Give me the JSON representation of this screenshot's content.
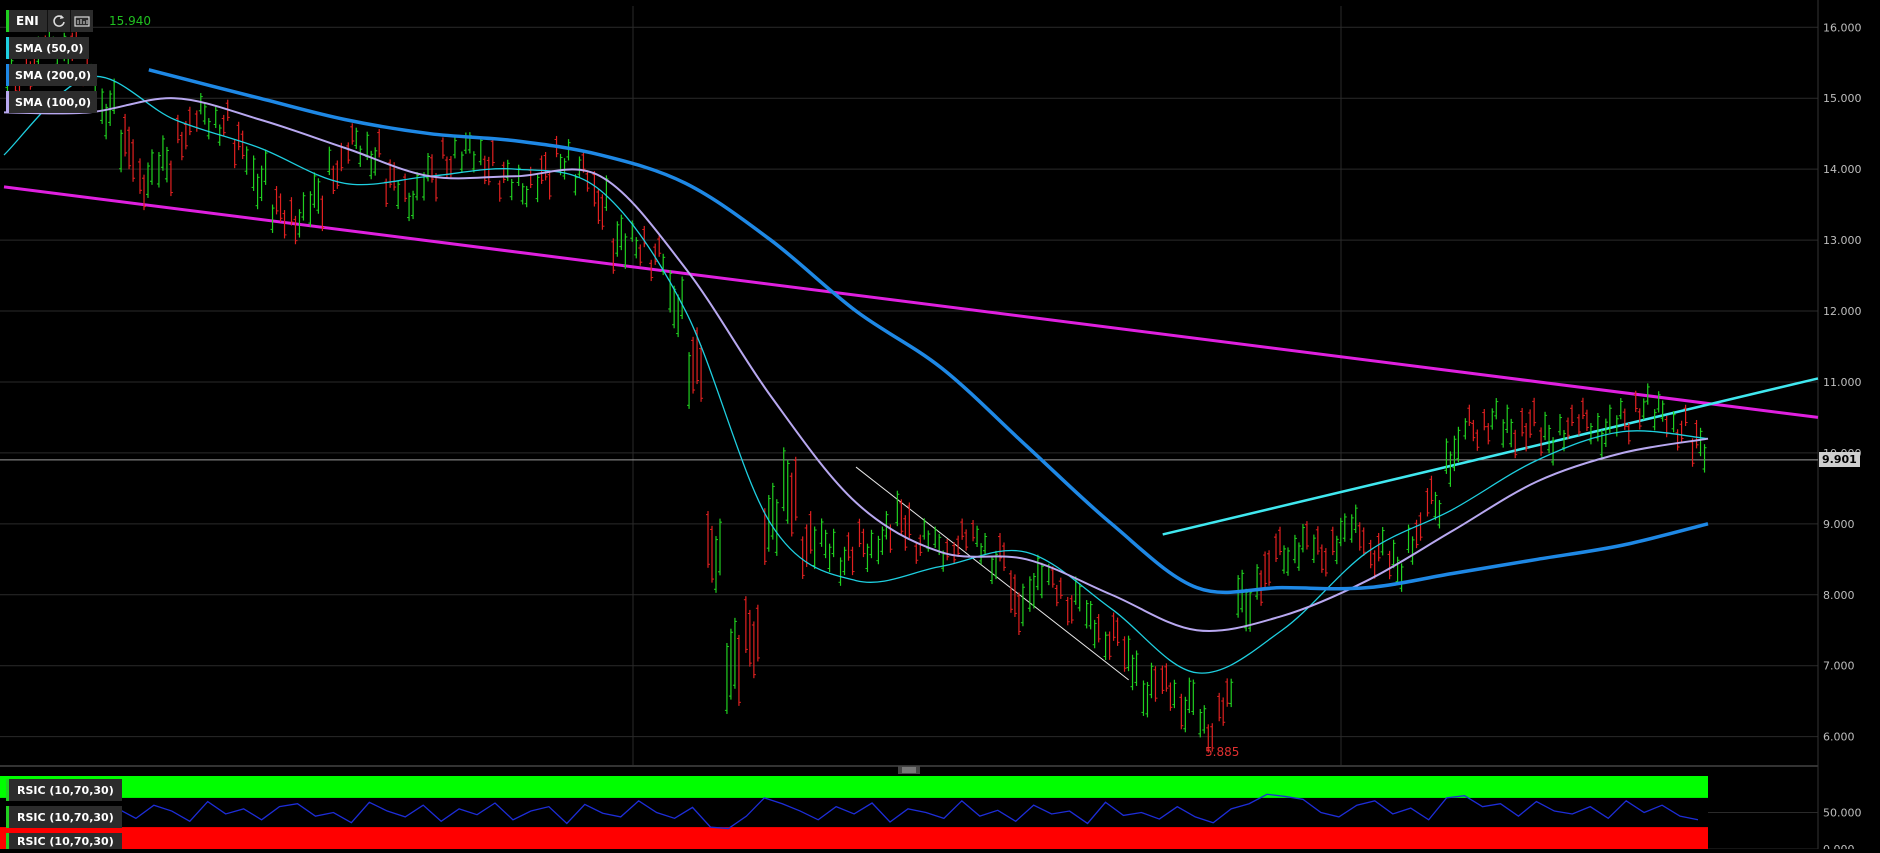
{
  "toolbar": {
    "symbol": "ENI",
    "refresh_icon": "refresh-icon",
    "chart_settings_icon": "chart-settings-icon"
  },
  "legends": [
    {
      "label": "SMA (50,0)",
      "color": "#1ecfe0"
    },
    {
      "label": "SMA (200,0)",
      "color": "#1e88e5"
    },
    {
      "label": "SMA (100,0)",
      "color": "#b8a8f0"
    }
  ],
  "indicator_legends": [
    {
      "label": "RSIC (10,70,30)"
    },
    {
      "label": "RSIC (10,70,30)"
    },
    {
      "label": "RSIC (10,70,30)"
    }
  ],
  "annotations": {
    "high_label": "15.940",
    "low_label": "5.885",
    "last_price": "9.901"
  },
  "colors": {
    "background": "#000000",
    "grid": "#2a2a2a",
    "up_candle": "#20d020",
    "down_candle": "#e02020",
    "trendline_magenta": "#e020e0",
    "trendline_cyan": "#40e8f0",
    "trendline_white": "#e8e8e8",
    "rsi_line": "#1d2dd8",
    "rsi_overbought": "#00ff00",
    "rsi_oversold": "#ff0000"
  },
  "chart_data": [
    {
      "type": "line",
      "ylim": [
        5.6,
        16.3
      ],
      "y_ticks": [
        "16.000",
        "15.000",
        "14.000",
        "13.000",
        "12.000",
        "11.000",
        "10.000",
        "9.000",
        "8.000",
        "7.000",
        "6.000"
      ],
      "series": [
        {
          "name": "SMA (50,0)",
          "x": [
            0,
            0.05,
            0.1,
            0.15,
            0.2,
            0.25,
            0.3,
            0.35,
            0.4,
            0.45,
            0.5,
            0.55,
            0.6,
            0.65,
            0.7,
            0.75,
            0.8,
            0.85,
            0.9,
            0.95,
            1.0
          ],
          "y": [
            14.2,
            15.3,
            14.7,
            14.3,
            13.8,
            13.9,
            14.0,
            13.7,
            12.0,
            9.0,
            8.2,
            8.4,
            8.6,
            7.8,
            6.9,
            7.5,
            8.6,
            9.2,
            9.9,
            10.3,
            10.2
          ]
        },
        {
          "name": "SMA (100,0)",
          "x": [
            0,
            0.05,
            0.1,
            0.15,
            0.2,
            0.25,
            0.3,
            0.35,
            0.4,
            0.45,
            0.5,
            0.55,
            0.6,
            0.65,
            0.7,
            0.75,
            0.8,
            0.85,
            0.9,
            0.95,
            1.0
          ],
          "y": [
            14.8,
            14.8,
            15.0,
            14.7,
            14.3,
            13.9,
            13.9,
            13.9,
            12.6,
            10.8,
            9.3,
            8.6,
            8.5,
            8.0,
            7.5,
            7.7,
            8.2,
            8.9,
            9.6,
            10.0,
            10.2
          ]
        },
        {
          "name": "SMA (200,0)",
          "x": [
            0.085,
            0.15,
            0.2,
            0.25,
            0.3,
            0.35,
            0.4,
            0.45,
            0.5,
            0.55,
            0.6,
            0.65,
            0.7,
            0.75,
            0.8,
            0.85,
            0.9,
            0.95,
            1.0
          ],
          "y": [
            15.4,
            15.0,
            14.7,
            14.5,
            14.4,
            14.2,
            13.8,
            13.0,
            12.0,
            11.2,
            10.1,
            9.0,
            8.1,
            8.1,
            8.1,
            8.3,
            8.5,
            8.7,
            9.0
          ]
        }
      ],
      "candles": [
        [
          15.1,
          15.4
        ],
        [
          15.3,
          15.7
        ],
        [
          15.6,
          15.9
        ],
        [
          15.5,
          15.9
        ],
        [
          15.2,
          15.5
        ],
        [
          14.6,
          15.1
        ],
        [
          14.0,
          14.6
        ],
        [
          13.6,
          14.1
        ],
        [
          13.8,
          14.3
        ],
        [
          14.3,
          14.7
        ],
        [
          14.6,
          14.9
        ],
        [
          14.5,
          14.8
        ],
        [
          14.1,
          14.5
        ],
        [
          13.6,
          14.1
        ],
        [
          13.2,
          13.6
        ],
        [
          13.1,
          13.5
        ],
        [
          13.3,
          13.8
        ],
        [
          13.8,
          14.2
        ],
        [
          14.2,
          14.5
        ],
        [
          14.0,
          14.4
        ],
        [
          13.6,
          14.0
        ],
        [
          13.4,
          13.8
        ],
        [
          13.7,
          14.1
        ],
        [
          14.0,
          14.3
        ],
        [
          14.1,
          14.4
        ],
        [
          13.9,
          14.3
        ],
        [
          13.7,
          14.0
        ],
        [
          13.6,
          13.9
        ],
        [
          13.7,
          14.1
        ],
        [
          14.0,
          14.3
        ],
        [
          13.8,
          14.1
        ],
        [
          13.3,
          13.8
        ],
        [
          12.7,
          13.2
        ],
        [
          12.8,
          13.1
        ],
        [
          12.6,
          12.9
        ],
        [
          11.8,
          12.4
        ],
        [
          10.8,
          11.6
        ],
        [
          8.2,
          9.0
        ],
        [
          6.5,
          7.5
        ],
        [
          7.0,
          7.8
        ],
        [
          8.6,
          9.4
        ],
        [
          9.0,
          9.9
        ],
        [
          8.4,
          9.0
        ],
        [
          8.5,
          8.9
        ],
        [
          8.3,
          8.7
        ],
        [
          8.5,
          8.9
        ],
        [
          8.6,
          9.0
        ],
        [
          8.8,
          9.3
        ],
        [
          8.6,
          8.9
        ],
        [
          8.5,
          8.8
        ],
        [
          8.6,
          8.9
        ],
        [
          8.6,
          8.9
        ],
        [
          8.3,
          8.7
        ],
        [
          7.6,
          8.2
        ],
        [
          7.9,
          8.4
        ],
        [
          8.0,
          8.3
        ],
        [
          7.7,
          8.1
        ],
        [
          7.4,
          7.8
        ],
        [
          7.2,
          7.6
        ],
        [
          6.8,
          7.3
        ],
        [
          6.4,
          6.9
        ],
        [
          6.5,
          6.9
        ],
        [
          6.2,
          6.7
        ],
        [
          5.9,
          6.3
        ],
        [
          6.3,
          6.7
        ],
        [
          7.6,
          8.2
        ],
        [
          8.0,
          8.5
        ],
        [
          8.4,
          8.8
        ],
        [
          8.5,
          8.9
        ],
        [
          8.4,
          8.8
        ],
        [
          8.6,
          9.0
        ],
        [
          8.7,
          9.1
        ],
        [
          8.4,
          8.8
        ],
        [
          8.2,
          8.6
        ],
        [
          8.6,
          9.0
        ],
        [
          9.1,
          9.5
        ],
        [
          9.7,
          10.2
        ],
        [
          10.2,
          10.5
        ],
        [
          10.3,
          10.6
        ],
        [
          10.1,
          10.5
        ],
        [
          10.2,
          10.6
        ],
        [
          10.0,
          10.4
        ],
        [
          10.2,
          10.5
        ],
        [
          10.3,
          10.6
        ],
        [
          10.1,
          10.5
        ],
        [
          10.3,
          10.6
        ],
        [
          10.5,
          10.8
        ],
        [
          10.4,
          10.7
        ],
        [
          10.2,
          10.5
        ],
        [
          9.9,
          10.3
        ]
      ],
      "trendlines": [
        {
          "name": "magenta-resistance",
          "from": [
            0,
            13.75
          ],
          "to": [
            1,
            10.5
          ]
        },
        {
          "name": "cyan-support",
          "from": [
            0.68,
            8.85
          ],
          "to": [
            1,
            11.05
          ]
        },
        {
          "name": "white-downtrend",
          "from": [
            0.5,
            9.8
          ],
          "to": [
            0.66,
            6.8
          ]
        }
      ],
      "last_price": 9.901,
      "high": 15.94,
      "low": 5.885
    },
    {
      "type": "line",
      "name": "RSIC (10,70,30)",
      "ylim": [
        0,
        100
      ],
      "y_ticks": [
        "50.000",
        "0.000"
      ],
      "overbought": 70,
      "oversold": 30,
      "values": [
        46,
        55,
        42,
        60,
        52,
        38,
        65,
        48,
        55,
        40,
        58,
        62,
        45,
        50,
        36,
        64,
        52,
        44,
        60,
        38,
        55,
        47,
        63,
        40,
        52,
        58,
        35,
        61,
        49,
        44,
        66,
        50,
        42,
        57,
        30,
        28,
        45,
        70,
        62,
        52,
        40,
        58,
        48,
        63,
        37,
        55,
        50,
        42,
        66,
        45,
        53,
        38,
        60,
        48,
        52,
        35,
        64,
        46,
        50,
        41,
        58,
        44,
        36,
        55,
        62,
        75,
        72,
        68,
        50,
        44,
        60,
        66,
        48,
        56,
        40,
        70,
        73,
        58,
        62,
        45,
        65,
        52,
        48,
        58,
        42,
        66,
        50,
        60,
        45,
        40
      ]
    }
  ]
}
